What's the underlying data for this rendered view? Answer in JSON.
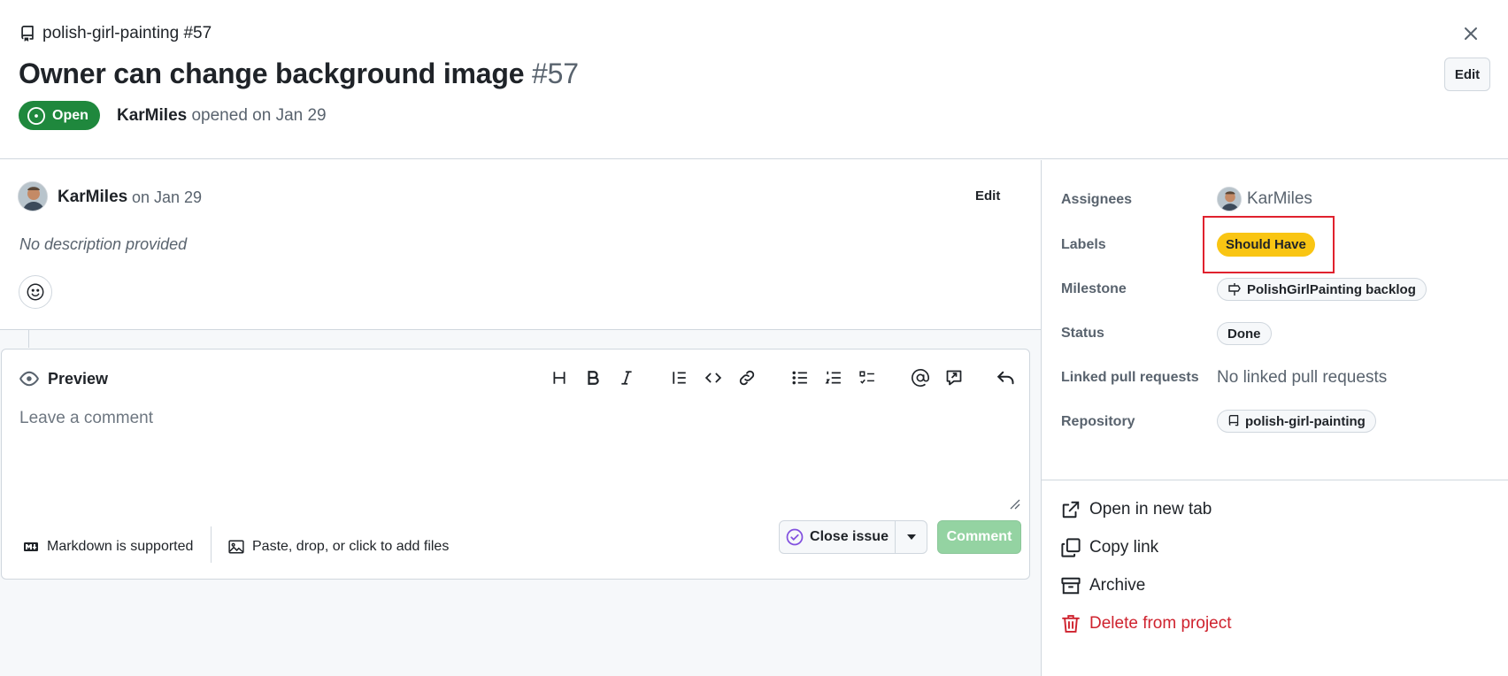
{
  "header": {
    "repo_line": "polish-girl-painting #57",
    "title": "Owner can change background image",
    "number": "#57",
    "status": "Open",
    "author": "KarMiles",
    "opened_text": "opened on Jan 29",
    "edit_label": "Edit"
  },
  "comment": {
    "author": "KarMiles",
    "date": "on Jan 29",
    "edit_label": "Edit",
    "body": "No description provided"
  },
  "editor": {
    "tab_label": "Preview",
    "placeholder": "Leave a comment",
    "markdown_note": "Markdown is supported",
    "attach_note": "Paste, drop, or click to add files",
    "close_issue_label": "Close issue",
    "comment_label": "Comment",
    "toolbar_icons": [
      "heading-icon",
      "bold-icon",
      "italic-icon",
      "quote-icon",
      "code-icon",
      "link-icon",
      "unordered-list-icon",
      "ordered-list-icon",
      "task-list-icon",
      "mention-icon",
      "reference-icon",
      "undo-icon"
    ]
  },
  "sidebar": {
    "fields": {
      "assignees_label": "Assignees",
      "assignee": "KarMiles",
      "labels_label": "Labels",
      "label": "Should Have",
      "label_color": "#f9c513",
      "milestone_label": "Milestone",
      "milestone": "PolishGirlPainting backlog",
      "status_label": "Status",
      "status": "Done",
      "linked_pr_label": "Linked pull requests",
      "linked_pr": "No linked pull requests",
      "repository_label": "Repository",
      "repository": "polish-girl-painting"
    },
    "actions": {
      "open_new_tab": "Open in new tab",
      "copy_link": "Copy link",
      "archive": "Archive",
      "delete": "Delete from project"
    }
  },
  "colors": {
    "open_green": "#1f883d",
    "danger_red": "#cf222e",
    "highlight_red": "#e0222e",
    "comment_disabled": "#94d3a2"
  }
}
